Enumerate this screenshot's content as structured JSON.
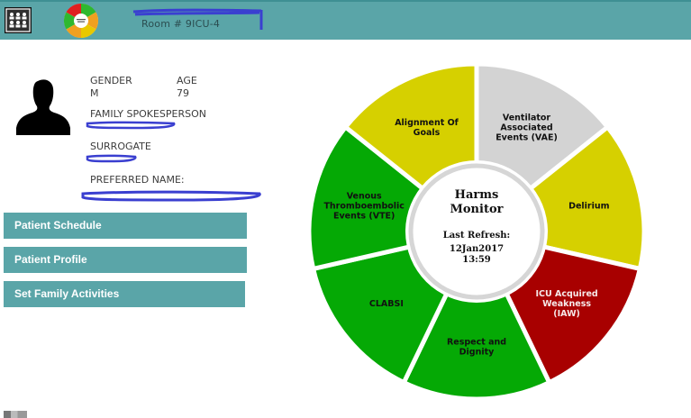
{
  "header": {
    "room_label": "Room # 9ICU-4",
    "grid_icon": "people-grid-icon",
    "mini_logo": "harms-wheel-mini-icon"
  },
  "patient": {
    "avatar_icon": "person-silhouette-icon",
    "gender_label": "GENDER",
    "gender_value": "M",
    "age_label": "AGE",
    "age_value": "79",
    "family_label": "FAMILY SPOKESPERSON",
    "surrogate_label": "SURROGATE",
    "preferred_name_label": "PREFERRED NAME:"
  },
  "nav": {
    "schedule": "Patient Schedule",
    "profile": "Patient Profile",
    "activities": "Set Family Activities"
  },
  "monitor": {
    "title_line1": "Harms",
    "title_line2": "Monitor",
    "refresh_label": "Last Refresh:",
    "refresh_date": "12Jan2017",
    "refresh_time": "13:59",
    "segments": [
      {
        "lines": [
          "Ventilator",
          "Associated",
          "Events (VAE)"
        ],
        "color": "#d3d3d3",
        "status": "gray"
      },
      {
        "lines": [
          "Delirium"
        ],
        "color": "#d6d000",
        "status": "yellow"
      },
      {
        "lines": [
          "ICU Acquired",
          "Weakness",
          "(IAW)"
        ],
        "color": "#a80000",
        "status": "red"
      },
      {
        "lines": [
          "Respect and",
          "Dignity"
        ],
        "color": "#05a905",
        "status": "green"
      },
      {
        "lines": [
          "CLABSI"
        ],
        "color": "#05a905",
        "status": "green"
      },
      {
        "lines": [
          "Venous",
          "Thromboembolic",
          "Events (VTE)"
        ],
        "color": "#05a905",
        "status": "green"
      },
      {
        "lines": [
          "Alignment Of",
          "Goals"
        ],
        "color": "#d6d000",
        "status": "yellow"
      }
    ]
  }
}
